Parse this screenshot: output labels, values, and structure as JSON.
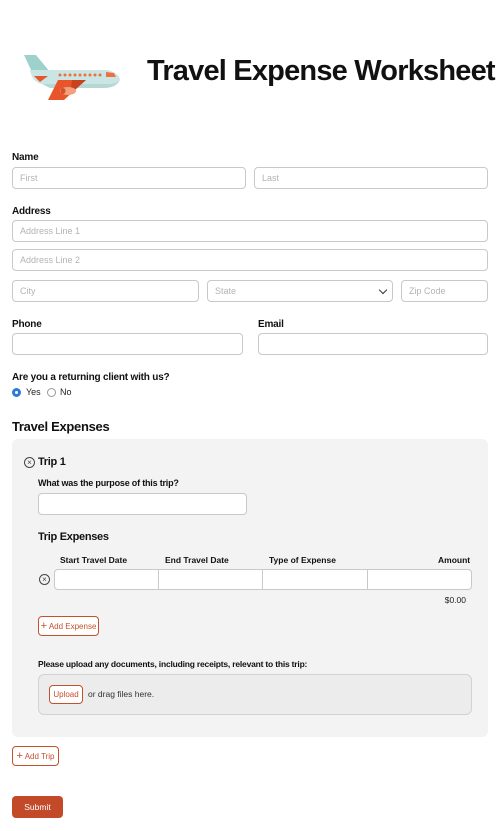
{
  "header": {
    "title": "Travel Expense Worksheet",
    "logo": "airplane-illustration"
  },
  "name": {
    "label": "Name",
    "first_placeholder": "First",
    "last_placeholder": "Last"
  },
  "address": {
    "label": "Address",
    "line1_placeholder": "Address Line 1",
    "line2_placeholder": "Address Line 2",
    "city_placeholder": "City",
    "state_placeholder": "State",
    "zip_placeholder": "Zip Code"
  },
  "phone": {
    "label": "Phone"
  },
  "email": {
    "label": "Email"
  },
  "returning": {
    "question": "Are you a returning client with us?",
    "options": [
      {
        "label": "Yes",
        "selected": true
      },
      {
        "label": "No",
        "selected": false
      }
    ]
  },
  "travel_expenses": {
    "section_title": "Travel Expenses",
    "trip": {
      "title": "Trip 1",
      "purpose_label": "What was the purpose of this trip?",
      "expenses_title": "Trip Expenses",
      "columns": [
        "Start Travel Date",
        "End Travel Date",
        "Type of Expense",
        "Amount"
      ],
      "total": "$0.00",
      "add_expense_label": "Add Expense",
      "upload_label": "Please upload any documents, including receipts, relevant to this trip:",
      "upload_button": "Upload",
      "drag_text": "or drag files here."
    },
    "add_trip_label": "Add Trip"
  },
  "submit_label": "Submit",
  "colors": {
    "accent": "#c24a29",
    "radio_selected": "#2e7bd6",
    "card_bg": "#f3f3f3"
  },
  "icons": {
    "remove": "circle-x-icon",
    "add": "plus-icon",
    "select": "chevron-down-icon"
  }
}
